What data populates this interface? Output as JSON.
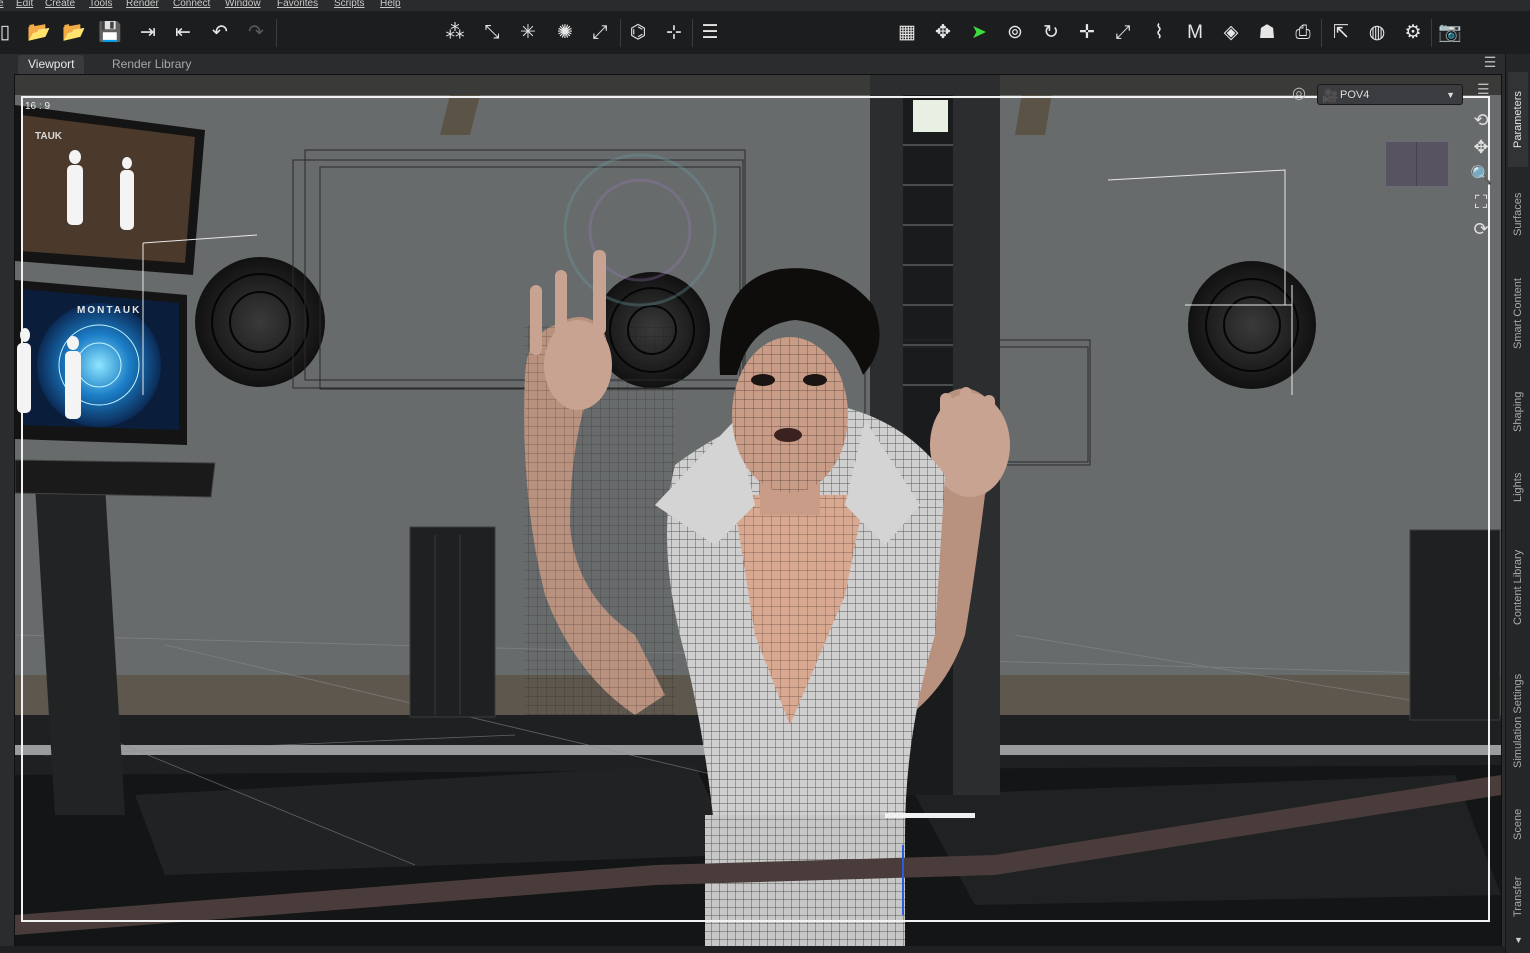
{
  "menubar": {
    "items": [
      "e",
      "Edit",
      "Create",
      "Tools",
      "Render",
      "Connect",
      "Window",
      "Favorites",
      "Scripts",
      "Help"
    ]
  },
  "toolbar": {
    "file_icons": [
      "new-file-icon",
      "open-icon",
      "merge-icon",
      "save-icon",
      "import-icon",
      "export-icon",
      "undo-icon",
      "redo-icon"
    ],
    "create_icons": [
      "create-group-icon",
      "create-spotlight-icon",
      "create-distant-light-icon",
      "create-point-light-icon",
      "create-linear-light-icon",
      "create-camera-icon",
      "create-null-icon",
      "align-icon"
    ],
    "tool_icons": [
      "grid-icon",
      "universal-tool-icon",
      "node-selection-icon",
      "orbit-icon",
      "rotate-icon",
      "translate-icon",
      "scale-icon",
      "joint-editor-icon",
      "geometry-editor-icon",
      "surface-selection-icon",
      "figure-tool-icon",
      "spot-render-icon",
      "active-pose-icon",
      "node-weight-icon",
      "render-settings-icon",
      "render-icon"
    ]
  },
  "tabs": {
    "viewport": "Viewport",
    "render_library": "Render Library"
  },
  "viewport": {
    "aspect_ratio": "16 : 9",
    "camera": "POV4",
    "monitor_text_top": "TAUK",
    "monitor_text_bottom": "MONTAUK"
  },
  "side_tabs": [
    "Parameters",
    "Surfaces",
    "Smart Content",
    "Shaping",
    "Lights",
    "Content Library",
    "Simulation Settings",
    "Scene",
    "Transfer"
  ],
  "colors": {
    "select_tool_active": "#3fdc3f",
    "frame_border": "#f2f2f2",
    "skin": "#d9a891",
    "outfit": "#cfcfcf"
  }
}
